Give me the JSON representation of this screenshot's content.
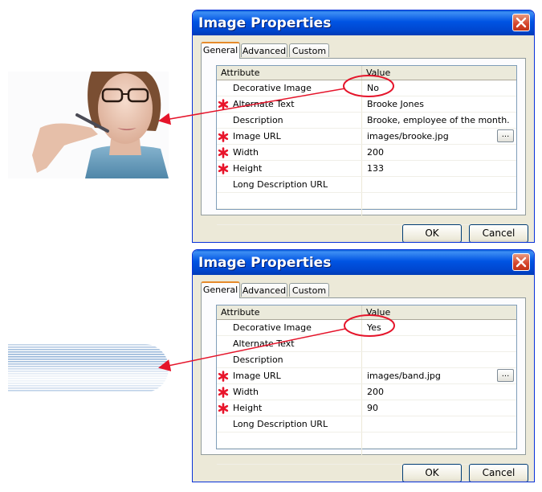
{
  "dialogs": [
    {
      "title": "Image Properties",
      "tabs": [
        "General",
        "Advanced",
        "Custom"
      ],
      "active_tab": "General",
      "columns": {
        "attribute": "Attribute",
        "value": "Value"
      },
      "rows": [
        {
          "label": "Decorative Image",
          "value": "No",
          "required": false
        },
        {
          "label": "Alternate Text",
          "value": "Brooke Jones",
          "required": true
        },
        {
          "label": "Description",
          "value": "Brooke, employee of the month.",
          "required": false
        },
        {
          "label": "Image URL",
          "value": "images/brooke.jpg",
          "required": true,
          "browse": "..."
        },
        {
          "label": "Width",
          "value": "200",
          "required": true
        },
        {
          "label": "Height",
          "value": "133",
          "required": true
        },
        {
          "label": "Long Description URL",
          "value": "",
          "required": false
        }
      ],
      "ok_label": "OK",
      "cancel_label": "Cancel"
    },
    {
      "title": "Image Properties",
      "tabs": [
        "General",
        "Advanced",
        "Custom"
      ],
      "active_tab": "General",
      "columns": {
        "attribute": "Attribute",
        "value": "Value"
      },
      "rows": [
        {
          "label": "Decorative Image",
          "value": "Yes",
          "required": false
        },
        {
          "label": "Alternate Text",
          "value": "",
          "required": false
        },
        {
          "label": "Description",
          "value": "",
          "required": false
        },
        {
          "label": "Image URL",
          "value": "images/band.jpg",
          "required": true,
          "browse": "..."
        },
        {
          "label": "Width",
          "value": "200",
          "required": true
        },
        {
          "label": "Height",
          "value": "90",
          "required": true
        },
        {
          "label": "Long Description URL",
          "value": "",
          "required": false
        }
      ],
      "ok_label": "OK",
      "cancel_label": "Cancel"
    }
  ],
  "colors": {
    "title_bar": "#0054e3",
    "dialog_bg": "#ece9d8",
    "required_marker": "#e8142a",
    "annotation": "#e5142a",
    "band_stripe": "#8fb0d6"
  },
  "icons": {
    "close": "close-icon",
    "required": "required-asterisk-icon"
  }
}
